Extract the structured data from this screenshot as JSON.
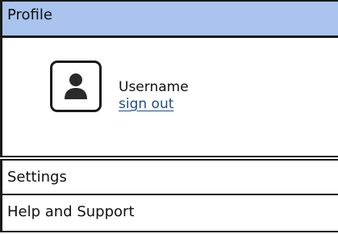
{
  "header": {
    "title": "Profile"
  },
  "profile": {
    "avatar_icon": "user-silhouette-icon",
    "username": "Username",
    "sign_out_label": "sign out"
  },
  "menu": {
    "items": [
      {
        "label": "Settings"
      },
      {
        "label": "Help and Support"
      }
    ]
  },
  "colors": {
    "header_background": "#a9c4ee",
    "link": "#1f4e8c",
    "border": "#1a1a1a"
  }
}
